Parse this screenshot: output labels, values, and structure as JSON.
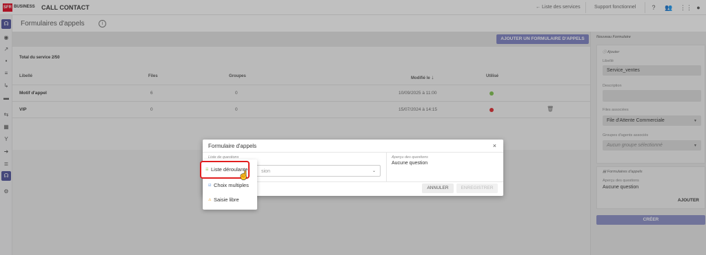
{
  "topbar": {
    "logo": "SFR",
    "logo_suffix": "BUSINESS",
    "app_title": "CALL CONTACT",
    "services_link": "← Liste des services",
    "support_link": "Support fonctionnel"
  },
  "page": {
    "title": "Formulaires d'appels",
    "add_button": "AJOUTER UN FORMULAIRE D'APPELS",
    "total": "Total du service 2/50"
  },
  "table": {
    "headers": {
      "libelle": "Libellé",
      "files": "Files",
      "groupes": "Groupes",
      "modifie": "Modifié le",
      "utilise": "Utilisé"
    },
    "rows": [
      {
        "libelle": "Motif d'appel",
        "files": "6",
        "groupes": "0",
        "modifie": "10/09/2025 à 11:00",
        "utilise_color": "#7cc24a"
      },
      {
        "libelle": "VIP",
        "files": "0",
        "groupes": "0",
        "modifie": "15/07/2024 à 14:15",
        "utilise_color": "#e0242a"
      }
    ]
  },
  "right_panel": {
    "header": "Nouveau Formulaire",
    "card1_title": "Ajouter",
    "libelle_label": "Libellé",
    "libelle_value": "Service_ventes",
    "description_label": "Description",
    "files_label": "Files associées",
    "files_value": "File d'Attente Commerciale",
    "groupes_label": "Groupes d'agents associés",
    "groupes_placeholder": "Aucun groupe sélectionné",
    "card2_title": "Formulaires d'appels",
    "apercu_label": "Aperçu des questions",
    "apercu_value": "Aucune question",
    "ajouter_label": "AJOUTER",
    "creer_label": "CRÉER"
  },
  "modal": {
    "title": "Formulaire d'appels",
    "close": "×",
    "liste_label": "Liste de questions",
    "select_placeholder": "sion",
    "apercu_label": "Aperçu des questions",
    "apercu_value": "Aucune question",
    "annuler": "ANNULER",
    "enregistrer": "ENREGISTRER"
  },
  "dropdown": {
    "items": [
      {
        "label": "Liste déroulante",
        "icon": "list-icon"
      },
      {
        "label": "Choix multiples",
        "icon": "checkbox-icon"
      },
      {
        "label": "Saisie libre",
        "icon": "warning-icon"
      }
    ]
  }
}
